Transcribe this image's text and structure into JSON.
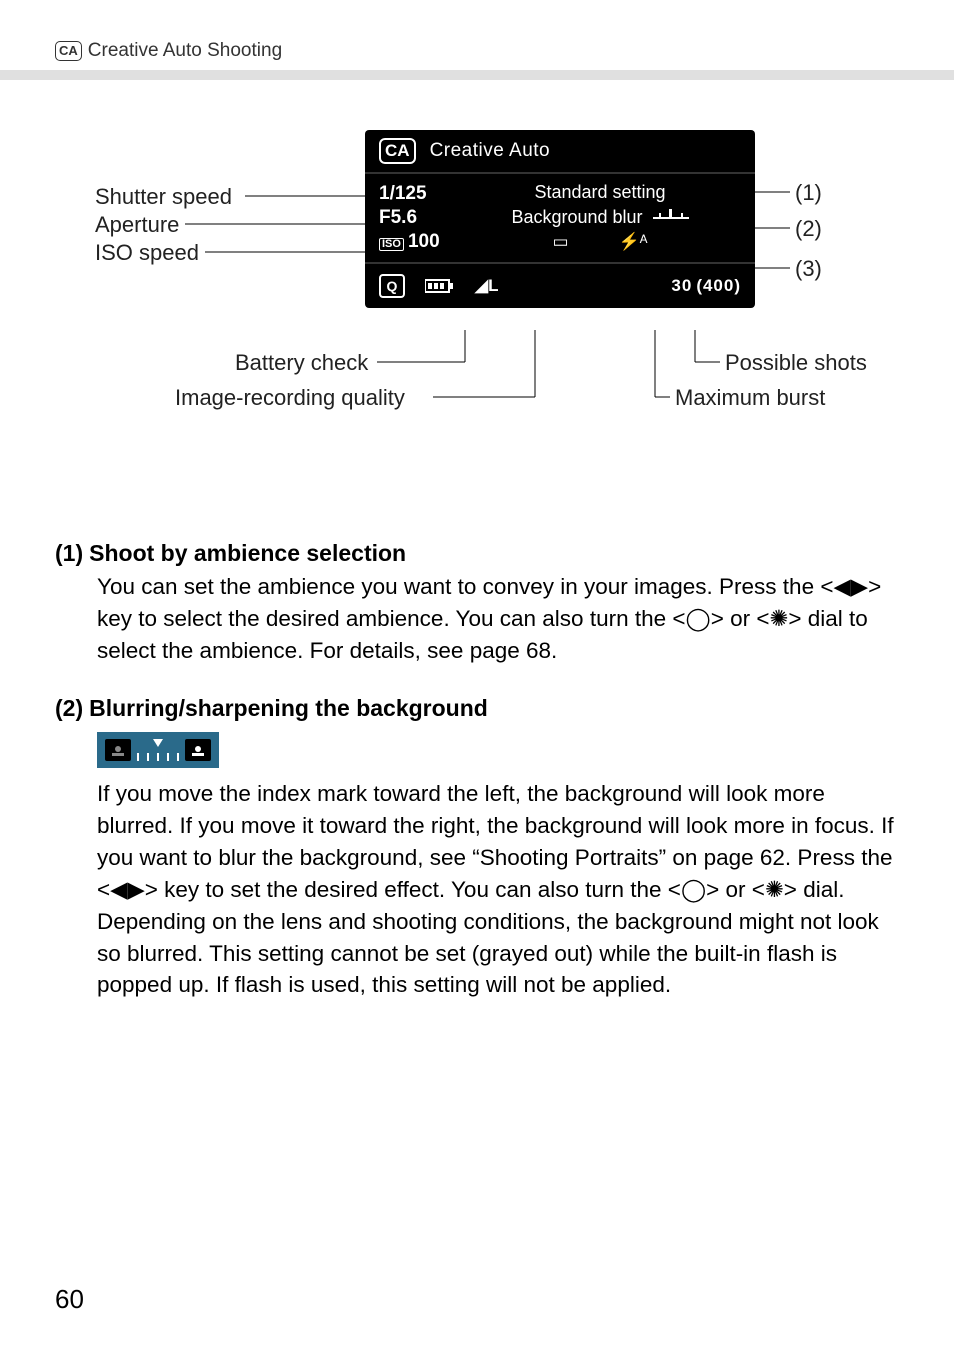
{
  "header": {
    "icon_label": "CA",
    "title": "Creative Auto Shooting"
  },
  "diagram": {
    "lcd": {
      "mode_icon": "CA",
      "mode_title": "Creative Auto",
      "shutter": "1/125",
      "aperture": "F5.6",
      "iso_label": "ISO",
      "iso_value": "100",
      "standard_setting": "Standard setting",
      "background_blur": "Background blur",
      "single_shot_glyph": "▭",
      "flash_glyph": "⚡ᴬ",
      "q_glyph": "Q",
      "quality_glyph": "◢L",
      "shots_main": "30",
      "shots_bracket": "(400)"
    },
    "left_labels": {
      "shutter": "Shutter speed",
      "aperture": "Aperture",
      "iso": "ISO speed"
    },
    "right_labels": {
      "r1": "(1)",
      "r2": "(2)",
      "r3": "(3)"
    },
    "bottom_labels": {
      "battery": "Battery check",
      "quality": "Image-recording quality",
      "possible": "Possible shots",
      "burst": "Maximum burst"
    }
  },
  "sections": {
    "s1": {
      "num": "(1)",
      "title": "Shoot by ambience selection",
      "body_a": "You can set the ambience you want to convey in your images. Press the <",
      "body_b": "> key to select the desired ambience. You can also turn the <",
      "body_c": "> or <",
      "body_d": "> dial to select the ambience. For details, see page 68.",
      "tri_lr": "◀▶",
      "dial1": "◯",
      "dial2": "✺"
    },
    "s2": {
      "num": "(2)",
      "title": "Blurring/sharpening the background",
      "p1_a": "If you move the index mark toward the left, the background will look more blurred. If you move it toward the right, the background will look more in focus. If you want to blur the background, see “Shooting Portraits” on page 62. Press the <",
      "p1_b": "> key to set the desired effect. You can also turn the <",
      "p1_c": "> or <",
      "p1_d": "> dial.",
      "p2": "Depending on the lens and shooting conditions, the background might not look so blurred. This setting cannot be set (grayed out) while the built-in flash is popped up. If flash is used, this setting will not be applied.",
      "tri_lr": "◀▶",
      "dial1": "◯",
      "dial2": "✺"
    }
  },
  "page_number": "60"
}
